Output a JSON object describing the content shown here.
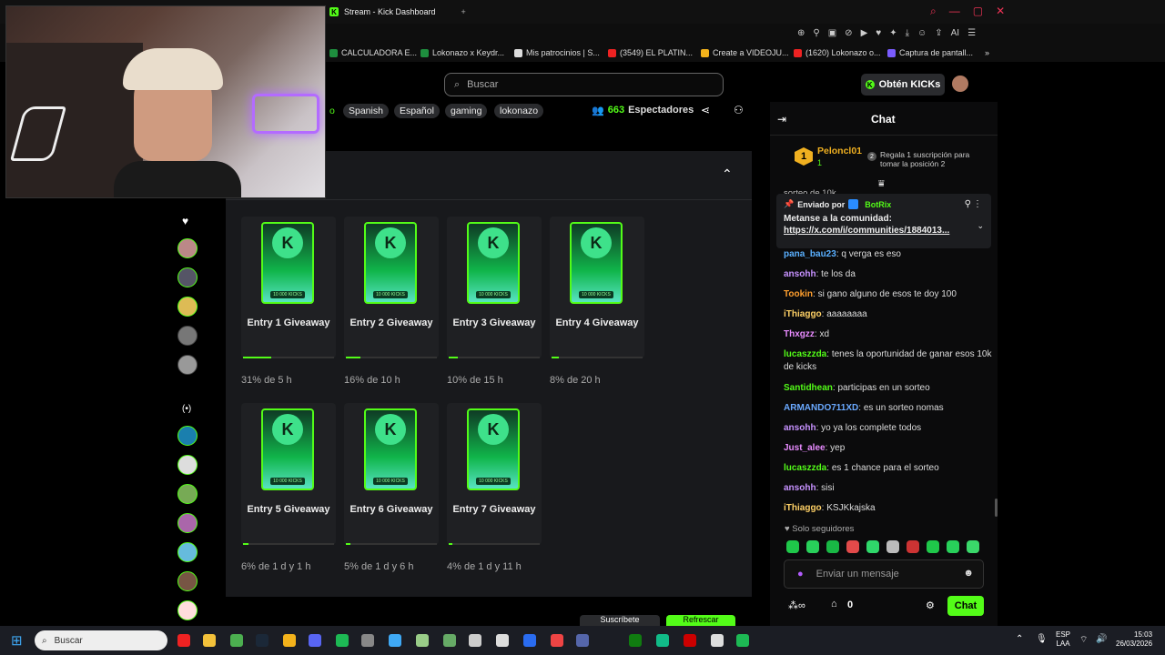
{
  "browser": {
    "tab_title": "Stream - Kick Dashboard",
    "bookmarks": [
      "CALCULADORA E...",
      "Lokonazo x Keydr...",
      "Mis patrocinios | S...",
      "(3549) EL PLATIN...",
      "Create a VIDEOJU...",
      "(1620) Lokonazo o...",
      "Captura de pantall..."
    ],
    "ai_label": "AI"
  },
  "header": {
    "search_placeholder": "Buscar",
    "get_kicks": "Obtén KICKs",
    "tags": [
      "Spanish",
      "Español",
      "gaming",
      "lokonazo"
    ],
    "tag_prefix": "o",
    "viewers": "663",
    "viewers_label": "Espectadores"
  },
  "giveaways": [
    {
      "title": "Entry 1 Giveaway",
      "progress_text": "31% de 5 h",
      "percent": 31
    },
    {
      "title": "Entry 2 Giveaway",
      "progress_text": "16% de 10 h",
      "percent": 16
    },
    {
      "title": "Entry 3 Giveaway",
      "progress_text": "10% de 15 h",
      "percent": 10
    },
    {
      "title": "Entry 4 Giveaway",
      "progress_text": "8% de 20 h",
      "percent": 8
    },
    {
      "title": "Entry 5 Giveaway",
      "progress_text": "6% de 1 d y 1 h",
      "percent": 6
    },
    {
      "title": "Entry 6 Giveaway",
      "progress_text": "5% de 1 d y 6 h",
      "percent": 5
    },
    {
      "title": "Entry 7 Giveaway",
      "progress_text": "4% de 1 d y 11 h",
      "percent": 4
    }
  ],
  "card_badge": "10 000 KICKS",
  "chat": {
    "title": "Chat",
    "leader": {
      "rank": "1",
      "name": "Peloncl01",
      "count": "1"
    },
    "leader_cta": "Regala 1 suscripción para tomar la posición 2",
    "leader_cta_rank": "2",
    "partial_line": "sorteo de 10k",
    "pinned": {
      "sent_by": "Enviado por",
      "author": "BotRix",
      "text": "Metanse a la comunidad:",
      "link": "https://x.com/i/communities/1884013..."
    },
    "messages": [
      {
        "user": "pana_bau23",
        "text": "q verga es eso",
        "color": "#5ab0ff"
      },
      {
        "user": "ansohh",
        "text": "te los da",
        "color": "#c792ff"
      },
      {
        "user": "Tookin",
        "text": "si gano alguno de esos te doy 100",
        "color": "#ff9f2e"
      },
      {
        "user": "iThiaggo",
        "text": "aaaaaaaa",
        "color": "#ffd166"
      },
      {
        "user": "Thxgzz",
        "text": "xd",
        "color": "#e88bff"
      },
      {
        "user": "lucaszzda",
        "text": "tenes la oportunidad de ganar esos 10k de kicks",
        "color": "#53fc18"
      },
      {
        "user": "Santidhean",
        "text": "participas en un sorteo",
        "color": "#53fc18"
      },
      {
        "user": "ARMANDO711XD",
        "text": "es un sorteo nomas",
        "color": "#6aa9ff"
      },
      {
        "user": "ansohh",
        "text": "yo ya los complete todos",
        "color": "#c792ff"
      },
      {
        "user": "Just_alee",
        "text": "yep",
        "color": "#e88bff"
      },
      {
        "user": "lucaszzda",
        "text": "es 1 chance para el sorteo",
        "color": "#53fc18"
      },
      {
        "user": "ansohh",
        "text": "sisi",
        "color": "#c792ff"
      },
      {
        "user": "iThiaggo",
        "text": "KSJKkajska",
        "color": "#ffd166"
      }
    ],
    "followers_only": "Solo seguidores",
    "input_placeholder": "Enviar un mensaje",
    "points": "0",
    "send_label": "Chat"
  },
  "bottom_buttons": {
    "subscribe": "Suscríbete",
    "refresh": "Refrescar"
  },
  "taskbar": {
    "search_placeholder": "Buscar",
    "lang_top": "ESP",
    "lang_bottom": "LAA",
    "time": "15:03",
    "date": "26/03/2026"
  }
}
